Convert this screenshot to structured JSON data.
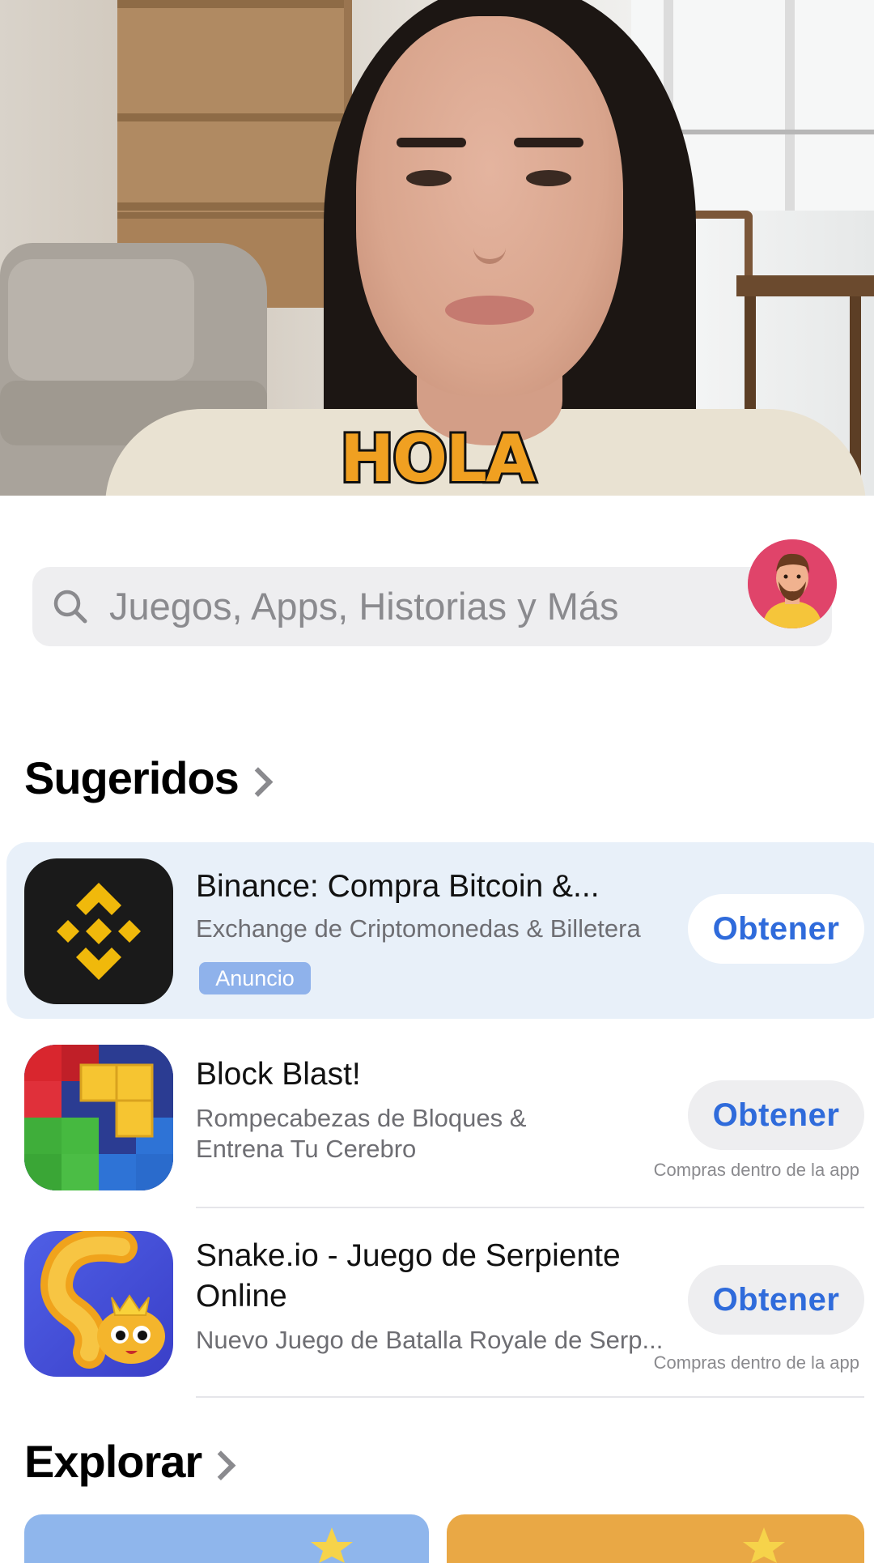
{
  "video": {
    "caption": "HOLA"
  },
  "search": {
    "placeholder": "Juegos, Apps, Historias y Más"
  },
  "sections": {
    "suggested_title": "Sugeridos",
    "explore_title": "Explorar"
  },
  "apps": [
    {
      "name": "Binance: Compra Bitcoin &...",
      "subtitle": "Exchange de Criptomonedas & Billetera",
      "badge": "Anuncio",
      "button": "Obtener"
    },
    {
      "name": "Block Blast!",
      "subtitle_line1": "Rompecabezas de Bloques &",
      "subtitle_line2": "Entrena Tu Cerebro",
      "button": "Obtener",
      "note": "Compras dentro de la app"
    },
    {
      "name_line1": "Snake.io - Juego de Serpiente",
      "name_line2": "Online",
      "subtitle": "Nuevo Juego de Batalla Royale de Serp...",
      "button": "Obtener",
      "note": "Compras dentro de la app"
    }
  ],
  "colors": {
    "accent": "#2f6bdb",
    "caption_fill": "#f0a021",
    "badge_bg": "#8fb2eb",
    "ad_card_bg": "#e8f0f9"
  },
  "icons": [
    "search-icon",
    "profile-avatar",
    "binance-logo",
    "block-blast-logo",
    "snake-io-logo",
    "chevron-right-icon",
    "star-icon"
  ]
}
